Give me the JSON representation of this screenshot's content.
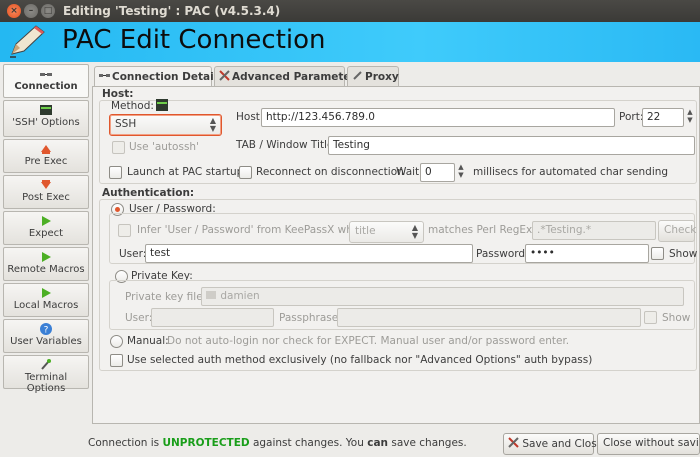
{
  "window": {
    "title": "Editing 'Testing' : PAC (v4.5.3.4)",
    "close_glyph": "×",
    "min_glyph": "–",
    "max_glyph": "□"
  },
  "banner": {
    "title": "PAC Edit Connection",
    "icon": "pencil-icon"
  },
  "sidebar": {
    "items": [
      {
        "label": "Connection",
        "icon": "connection-icon"
      },
      {
        "label": "'SSH' Options",
        "icon": "ssh-icon"
      },
      {
        "label": "Pre Exec",
        "icon": "pre-exec-icon"
      },
      {
        "label": "Post Exec",
        "icon": "post-exec-icon"
      },
      {
        "label": "Expect",
        "icon": "play-icon"
      },
      {
        "label": "Remote Macros",
        "icon": "play-icon"
      },
      {
        "label": "Local Macros",
        "icon": "play-icon"
      },
      {
        "label": "User Variables",
        "icon": "help-icon"
      },
      {
        "label": "Terminal Options",
        "icon": "terminal-icon"
      }
    ]
  },
  "tabs": [
    {
      "label": "Connection Details",
      "icon": "connection-icon"
    },
    {
      "label": "Advanced Parameters",
      "icon": "tools-icon"
    },
    {
      "label": "Proxy",
      "icon": "proxy-icon"
    }
  ],
  "host": {
    "section": "Host:",
    "method_label": "Method:",
    "method_value": "SSH",
    "use_autossh": "Use 'autossh'",
    "host_label": "Host:",
    "host_value": "http://123.456.789.0",
    "port_label": "Port:",
    "port_value": "22",
    "tab_title_label": "TAB / Window Title:",
    "tab_title_value": "Testing",
    "launch_startup": "Launch at PAC startup",
    "reconnect": "Reconnect on disconnection",
    "wait_label": "Wait",
    "wait_value": "0",
    "wait_suffix": "millisecs for automated char sending"
  },
  "auth": {
    "section": "Authentication:",
    "user_password": "User / Password:",
    "infer_label": "Infer 'User / Password' from KeePassX where:",
    "infer_field": "title",
    "matches_label": "matches Perl RegExp:",
    "regexp_value": ".*Testing.*",
    "check_button": "Check",
    "user_label": "User:",
    "user_value": "test",
    "password_label": "Password:",
    "password_value": "••••",
    "show_label": "Show",
    "private_key": "Private Key:",
    "private_key_file_label": "Private key file:",
    "private_key_file_value": "damien",
    "pk_user_label": "User:",
    "passphrase_label": "Passphrase:",
    "pk_show_label": "Show",
    "manual_label": "Manual:",
    "manual_desc": "Do not auto-login nor check for EXPECT. Manual user and/or password enter.",
    "exclusive": "Use selected auth method exclusively (no fallback nor \"Advanced Options\" auth bypass)"
  },
  "footer": {
    "status_prefix": "Connection is",
    "status_state": "UNPROTECTED",
    "status_mid": "against changes. You",
    "status_can": "can",
    "status_suffix": "save changes.",
    "save_button": "Save and Close",
    "close_button": "Close without saving"
  },
  "colors": {
    "banner": "#3fcbfb",
    "accent": "#e0572d",
    "unprotected": "#1a9e1a"
  }
}
